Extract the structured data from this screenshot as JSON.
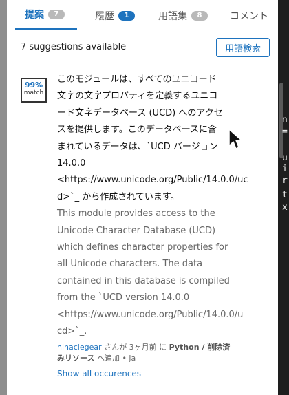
{
  "tabs": [
    {
      "label": "提案",
      "badge": "7"
    },
    {
      "label": "履歴",
      "badge": "1"
    },
    {
      "label": "用語集",
      "badge": "8"
    },
    {
      "label": "コメント"
    }
  ],
  "toolbar": {
    "suggestions_count": "7 suggestions available",
    "term_search_label": "用語検索"
  },
  "suggestion": {
    "match_percent": "99%",
    "match_label": "match",
    "source_text": "このモジュールは、すべてのユニコード\n文字の文字プロパティを定義するユニコ\nード文字データベース (UCD) へのアクセ\nスを提供します。このデータベースに含\nまれているデータは、`UCD バージョン\n14.0.0\n<https://www.unicode.org/Public/14.0.0/uc\nd>`_ から作成されています。",
    "target_text": "This module provides access to the\nUnicode Character Database (UCD)\nwhich defines character properties for\nall Unicode characters. The data\ncontained in this database is compiled\nfrom the `UCD version 14.0.0\n<https://www.unicode.org/Public/14.0.0/u\ncd>`_.",
    "meta": {
      "user": "hinaclegear",
      "text1": " さんが 3ヶ月前 に ",
      "project": "Python / 削除済",
      "project_cont": "みリソース",
      "text2": " へ追加 • ja"
    },
    "show_all_label": "Show all occurences"
  },
  "background_code": [
    "n",
    "=",
    "u",
    "i",
    "r",
    "t",
    "x"
  ],
  "colors": {
    "accent": "#1e73be",
    "badge_gray": "#b9b9b9"
  }
}
